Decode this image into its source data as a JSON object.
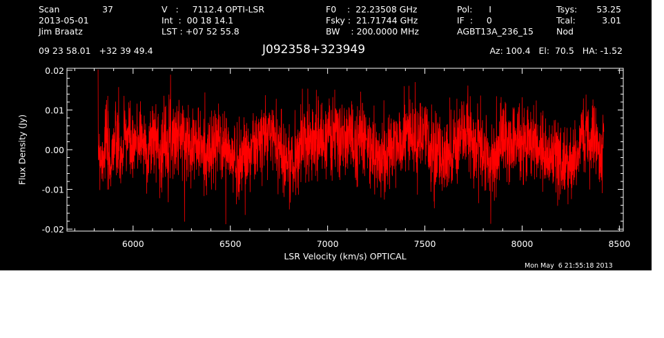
{
  "header": {
    "col1": {
      "scan_label": "Scan",
      "scan_value": "37",
      "date": "2013-05-01",
      "observer": "Jim Braatz"
    },
    "col2": {
      "velocity": "V   :     7112.4 OPTI-LSR",
      "integration": "Int  :  00 18 14.1",
      "lst": "LST : +07 52 55.8"
    },
    "col3": {
      "f0": "F0    :  22.23508 GHz",
      "fsky": "Fsky :  21.71744 GHz",
      "bw": "BW    : 200.0000 MHz"
    },
    "col4": {
      "pol": "Pol:      I",
      "if": "IF  :     0",
      "project": "AGBT13A_236_15"
    },
    "col5": {
      "tsys_label": "Tsys:",
      "tsys_value": "53.25",
      "tcal_label": "Tcal:",
      "tcal_value": "3.01",
      "mode": "Nod"
    },
    "coords": "09 23 58.01   +32 39 49.4",
    "source": "J092358+323949",
    "pointing": "Az: 100.4   El:  70.5   HA: -1.52"
  },
  "timestamp": "Mon May  6 21:55:18 2013",
  "colors": {
    "background": "#000000",
    "foreground": "#ffffff",
    "trace": "#ff0000"
  },
  "chart_data": {
    "type": "line",
    "xlabel": "LSR Velocity (km/s) OPTICAL",
    "ylabel": "Flux Density (Jy)",
    "xlim": [
      5660,
      8520
    ],
    "ylim": [
      -0.0205,
      0.0205
    ],
    "x_ticks": [
      6000,
      6500,
      7000,
      7500,
      8000,
      8500
    ],
    "x_tick_labels": [
      "6000",
      "6500",
      "7000",
      "7500",
      "8000",
      "8500"
    ],
    "y_ticks": [
      -0.02,
      -0.01,
      0.0,
      0.01,
      0.02
    ],
    "y_tick_labels": [
      "-0.02",
      "-0.01",
      "0.00",
      "0.01",
      "0.02"
    ],
    "grid": false,
    "series": [
      {
        "x_start": 5820,
        "x_step": 20,
        "rms": 0.0048,
        "values": [
          0.0015,
          -0.0025,
          0.003,
          -0.004,
          0.002,
          0.001,
          -0.003,
          0.004,
          0.0025,
          -0.002,
          0.003,
          0.0035,
          0.001,
          -0.0015,
          0.004,
          0.003,
          -0.001,
          0.002,
          0.0035,
          0.0045,
          0.003,
          0.004,
          0.0025,
          0.002,
          0.003,
          0.0015,
          0.001,
          -0.0005,
          -0.001,
          -0.0015,
          0.001,
          0.002,
          0.0015,
          0.0005,
          -0.002,
          -0.0025,
          -0.003,
          -0.002,
          -0.001,
          -0.0005,
          0.0005,
          0.001,
          0.0025,
          0.003,
          0.0045,
          0.004,
          0.002,
          -0.0005,
          -0.002,
          -0.003,
          -0.004,
          -0.0025,
          0.0015,
          0.002,
          0.003,
          0.0035,
          0.0025,
          0.0015,
          0.0025,
          0.003,
          0.004,
          0.003,
          0.002,
          0.0025,
          0.0035,
          0.002,
          0.0015,
          0.0045,
          0.003,
          0.0005,
          0.001,
          -0.0015,
          -0.0025,
          0.0,
          -0.003,
          -0.001,
          0.001,
          0.0005,
          0.0015,
          0.0035,
          0.0045,
          0.003,
          0.002,
          0.0015,
          0.0035,
          0.001,
          -0.0005,
          -0.001,
          -0.0025,
          -0.0015,
          -0.0005,
          0.001,
          0.0015,
          0.0025,
          0.003,
          0.004,
          0.0035,
          0.001,
          0.0005,
          -0.001,
          -0.003,
          -0.0035,
          -0.002,
          0.0015,
          0.0025,
          0.001,
          0.002,
          0.0035,
          0.003,
          0.0005,
          0.002,
          0.003,
          0.002,
          0.0005,
          0.0,
          -0.001,
          -0.0025,
          -0.003,
          -0.0015,
          -0.004,
          -0.005,
          -0.0035,
          -0.002,
          -0.001,
          0.002,
          0.003,
          0.004,
          0.005,
          0.0035,
          -0.0025,
          0.0015
        ]
      }
    ]
  }
}
